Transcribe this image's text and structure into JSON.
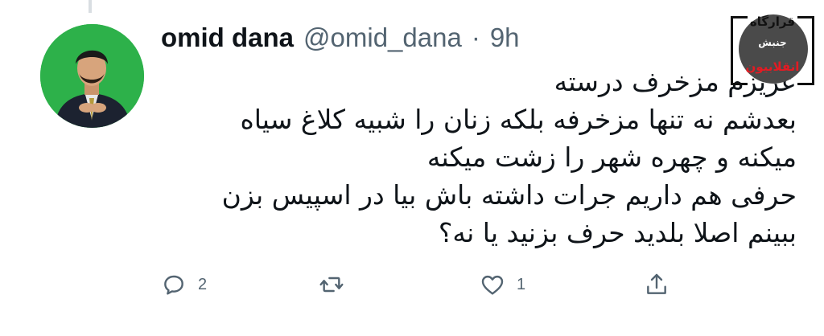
{
  "tweet": {
    "author_name": "omid dana",
    "author_handle": "@omid_dana",
    "separator": "·",
    "time": "9h",
    "text_lines": [
      "عزیزم مزخرف درسته",
      "بعدشم نه تنها مزخرفه بلکه زنان را شبیه کلاغ سیاه",
      "میکنه و چهره شهر را زشت میکنه",
      "حرفی هم داریم جرات داشته باش بیا در اسپیس بزن",
      "ببینم اصلا بلدید حرف بزنید یا نه؟"
    ]
  },
  "actions": {
    "reply_count": "2",
    "like_count": "1"
  },
  "watermark": {
    "line1": "قرارگاه",
    "line2": "جنبش",
    "line3": "انقلابیون"
  },
  "icons": {
    "reply": "reply-icon",
    "retweet": "retweet-icon",
    "like": "heart-icon",
    "share": "share-icon"
  },
  "colors": {
    "text_primary": "#0f1419",
    "text_secondary": "#536471",
    "avatar_bg": "#2db14a",
    "watermark_red": "#e31b23"
  }
}
